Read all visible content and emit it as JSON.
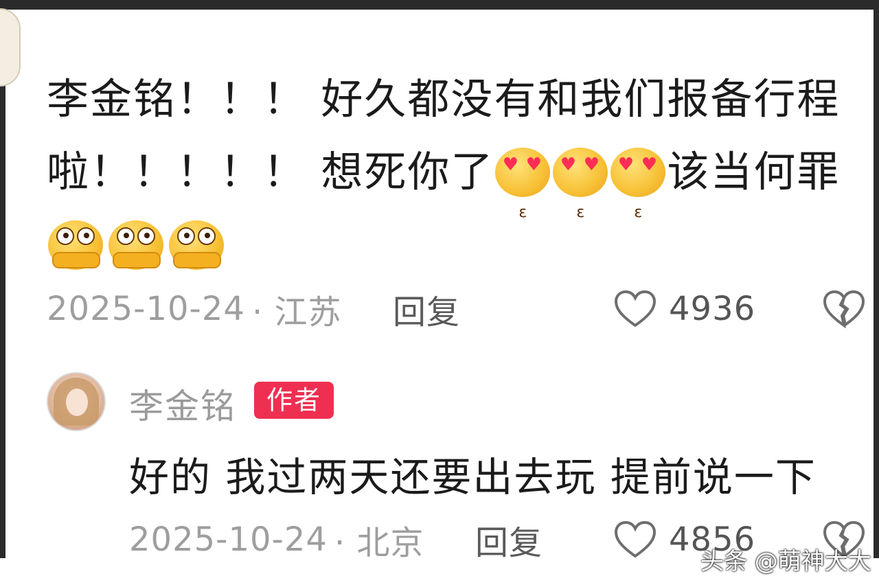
{
  "comment": {
    "line1": "李金铭！！！ 好久都没有和我们报备行程",
    "line2_text": "啦！！！！！ 想死你了",
    "line2_suffix": "该当何罪",
    "heart_emojis": [
      "kissing-heart-eyes-icon",
      "kissing-heart-eyes-icon",
      "kissing-heart-eyes-icon"
    ],
    "think_emojis": [
      "pleading-hands-icon",
      "pleading-hands-icon",
      "pleading-hands-icon"
    ],
    "date": "2025-10-24",
    "location": "· 江苏",
    "reply_label": "回复",
    "likes": "4936"
  },
  "reply": {
    "author": "李金铭",
    "badge": "作者",
    "text": "好的 我过两天还要出去玩 提前说一下",
    "date": "2025-10-24",
    "location": "· 北京",
    "reply_label": "回复",
    "likes": "4856"
  },
  "watermark": "头条 @萌神大大",
  "colors": {
    "badge": "#ef2f52",
    "meta_text": "#9e9e9e",
    "frame": "#2b2b2b"
  }
}
